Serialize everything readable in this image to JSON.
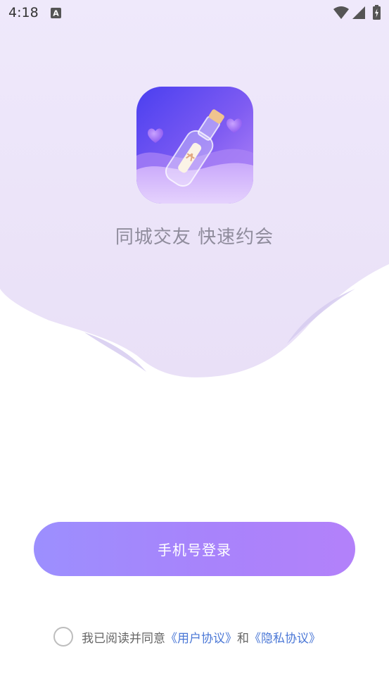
{
  "status_bar": {
    "time": "4:18",
    "notification_icon": "font-a-icon",
    "wifi_icon": "wifi-icon",
    "signal_icon": "cellular-signal-icon",
    "battery_icon": "battery-charging-icon"
  },
  "brand": {
    "logo_icon": "message-bottle-icon",
    "slogan": "同城交友 快速约会"
  },
  "login": {
    "phone_login_label": "手机号登录"
  },
  "agreement": {
    "prefix": "我已阅读并同意",
    "user_agreement": "《用户协议》",
    "conjunction": "和",
    "privacy_policy": "《隐私协议》"
  },
  "colors": {
    "background_top": "#ede5fb",
    "button_start": "#9c8ffe",
    "button_end": "#b381fa",
    "link": "#4a77d6",
    "slogan": "#8f8c9c"
  }
}
